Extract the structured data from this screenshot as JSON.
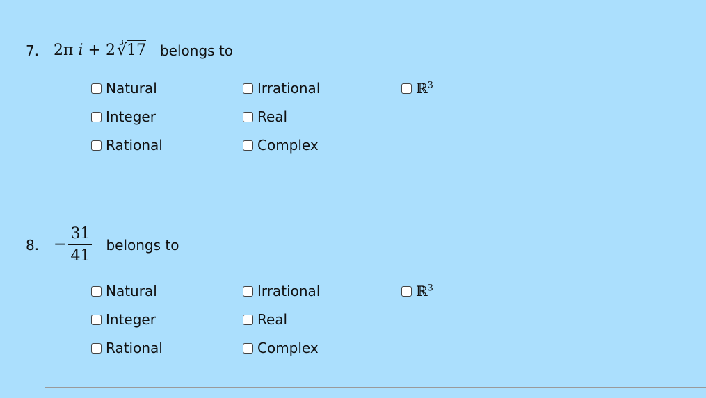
{
  "questions": [
    {
      "number": "7.",
      "expr": {
        "coef": "2π",
        "i": "i",
        "plus": "+",
        "coef2": "2",
        "root_index": "3",
        "radicand": "17"
      },
      "belongs_text": "belongs to",
      "options": [
        {
          "label": "Natural",
          "checked": false
        },
        {
          "label": "Irrational",
          "checked": false
        },
        {
          "label": "ℝ",
          "sup": "3",
          "checked": false
        },
        {
          "label": "Integer",
          "checked": false
        },
        {
          "label": "Real",
          "checked": false
        },
        {
          "label": "Rational",
          "checked": false
        },
        {
          "label": "Complex",
          "checked": false
        }
      ]
    },
    {
      "number": "8.",
      "expr": {
        "sign": "−",
        "numerator": "31",
        "denominator": "41"
      },
      "belongs_text": "belongs to",
      "options": [
        {
          "label": "Natural",
          "checked": false
        },
        {
          "label": "Irrational",
          "checked": false
        },
        {
          "label": "ℝ",
          "sup": "3",
          "checked": false
        },
        {
          "label": "Integer",
          "checked": false
        },
        {
          "label": "Real",
          "checked": false
        },
        {
          "label": "Rational",
          "checked": false
        },
        {
          "label": "Complex",
          "checked": false
        }
      ]
    }
  ]
}
